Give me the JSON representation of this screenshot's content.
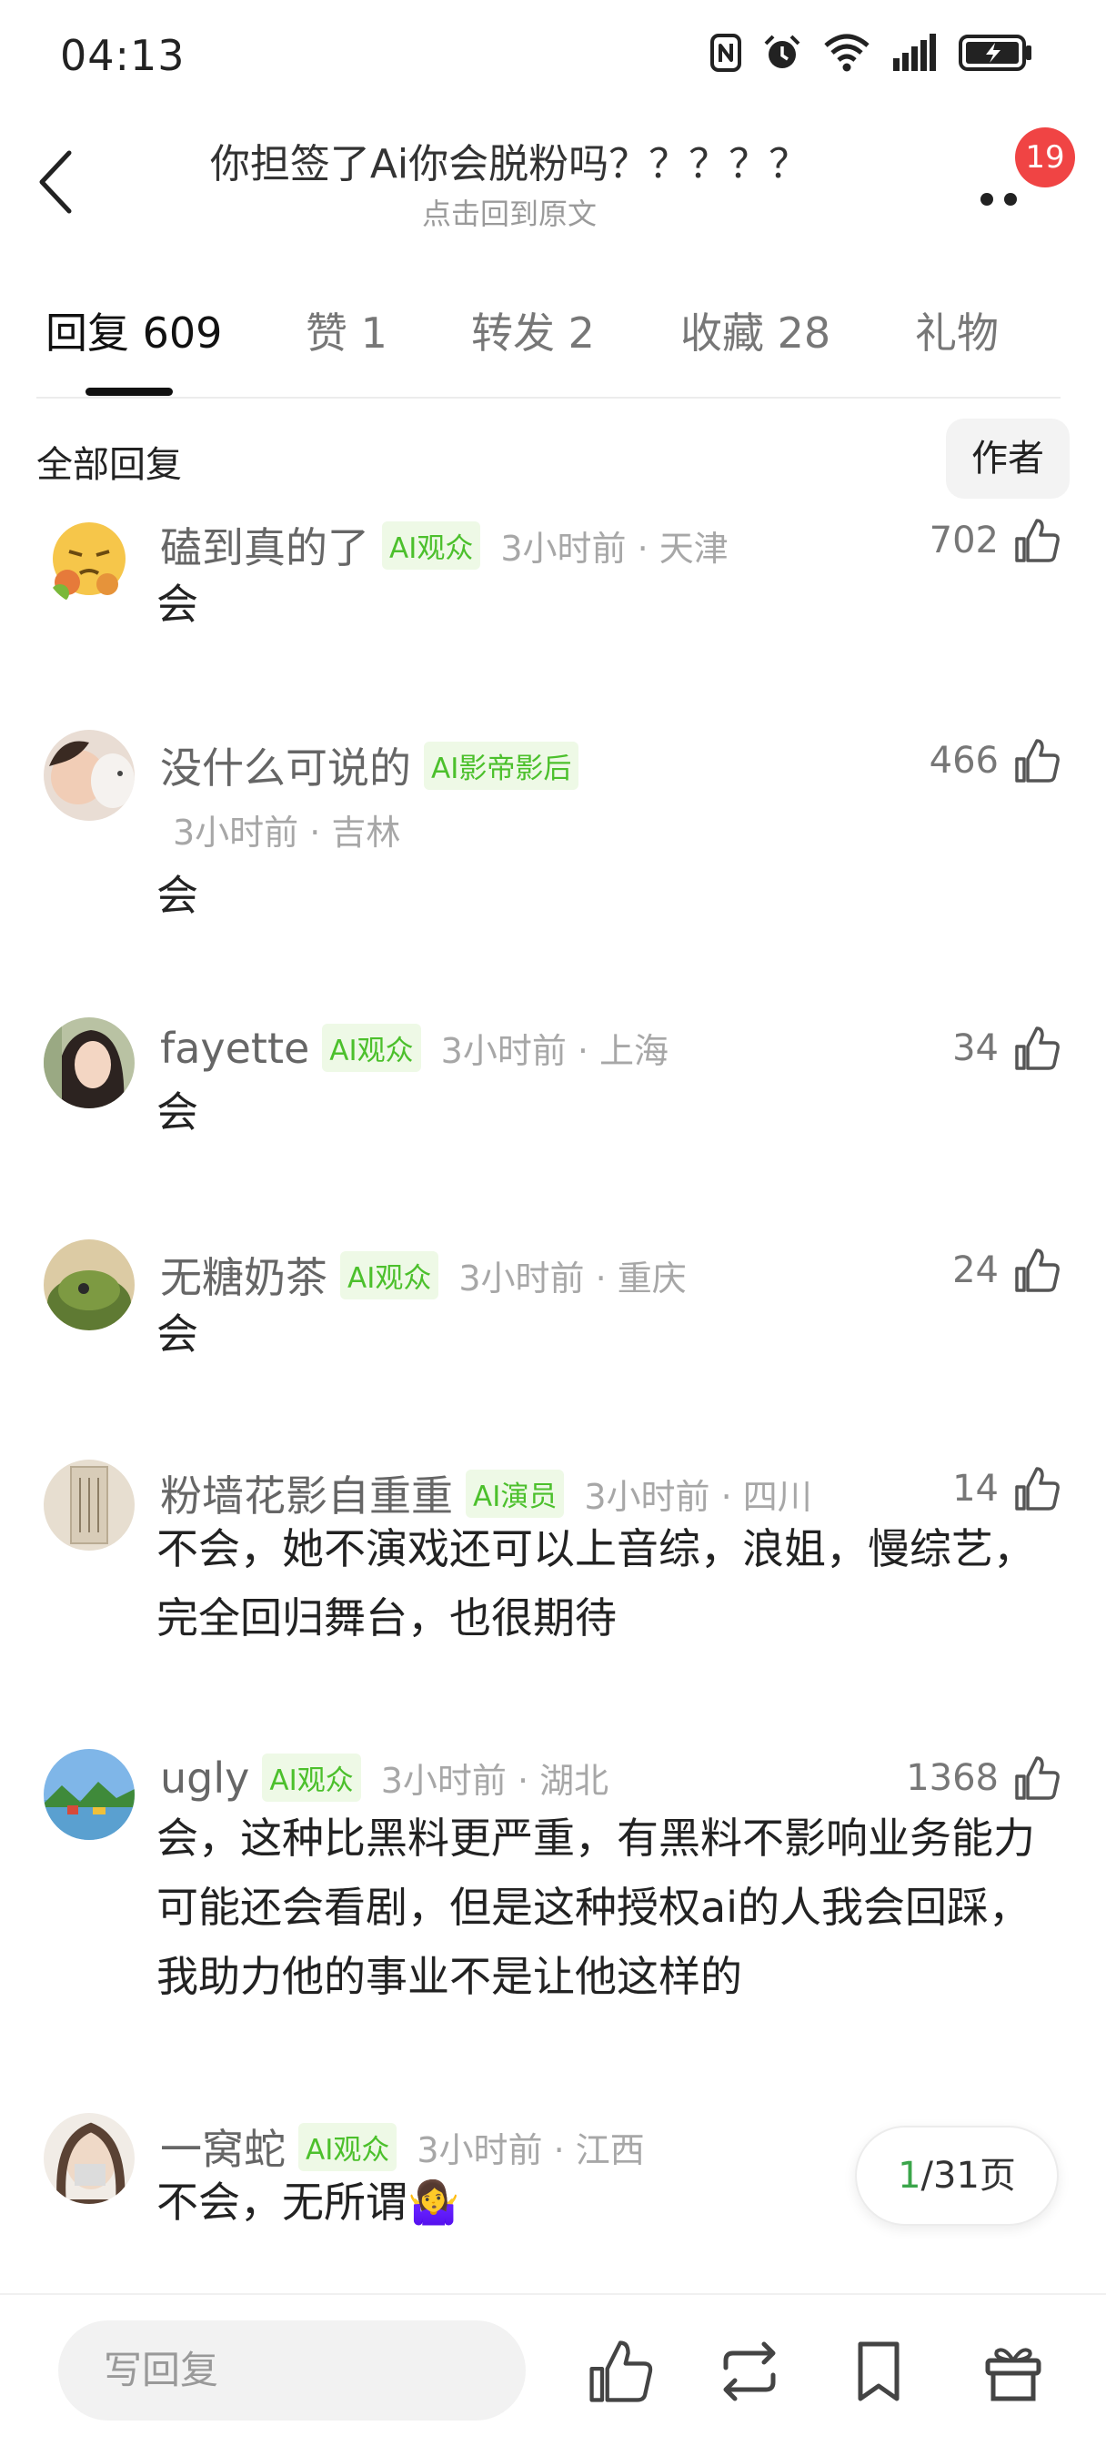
{
  "status_bar": {
    "time": "04:13",
    "icons": [
      "nfc-icon",
      "alarm-icon",
      "wifi-icon",
      "signal-icon",
      "battery-charging-icon"
    ]
  },
  "header": {
    "title": "你担签了Ai你会脱粉吗？？？？？",
    "subtitle": "点击回到原文",
    "notification_count": "19"
  },
  "tabs": [
    {
      "label": "回复",
      "count": "609",
      "active": true
    },
    {
      "label": "赞",
      "count": "1",
      "active": false
    },
    {
      "label": "转发",
      "count": "2",
      "active": false
    },
    {
      "label": "收藏",
      "count": "28",
      "active": false
    },
    {
      "label": "礼物",
      "count": "",
      "active": false
    }
  ],
  "filter": {
    "all_replies": "全部回复",
    "author_button": "作者"
  },
  "comments": [
    {
      "name": "磕到真的了",
      "badge": "AI观众",
      "meta": "3小时前 · 天津",
      "likes": "702",
      "text": "会"
    },
    {
      "name": "没什么可说的",
      "badge": "AI影帝影后",
      "meta": "3小时前 · 吉林",
      "likes": "466",
      "text": "会"
    },
    {
      "name": "fayette",
      "badge": "AI观众",
      "meta": "3小时前 · 上海",
      "likes": "34",
      "text": "会"
    },
    {
      "name": "无糖奶茶",
      "badge": "AI观众",
      "meta": "3小时前 · 重庆",
      "likes": "24",
      "text": "会"
    },
    {
      "name": "粉墙花影自重重",
      "badge": "AI演员",
      "meta": "3小时前 · 四川",
      "likes": "14",
      "text": "不会，她不演戏还可以上音综，浪姐，慢综艺，完全回归舞台，也很期待"
    },
    {
      "name": "ugly",
      "badge": "AI观众",
      "meta": "3小时前 · 湖北",
      "likes": "1368",
      "text": "会，这种比黑料更严重，有黑料不影响业务能力可能还会看剧，但是这种授权ai的人我会回踩，我助力他的事业不是让他这样的"
    },
    {
      "name": "一窝蛇",
      "badge": "AI观众",
      "meta": "3小时前 · 江西",
      "likes": "",
      "text": "不会，无所谓🤷‍♀️"
    }
  ],
  "pagination": {
    "current": "1",
    "total": "/31页"
  },
  "bottom_bar": {
    "reply_placeholder": "写回复",
    "icons": [
      "like-icon",
      "repost-icon",
      "bookmark-icon",
      "gift-icon"
    ]
  }
}
